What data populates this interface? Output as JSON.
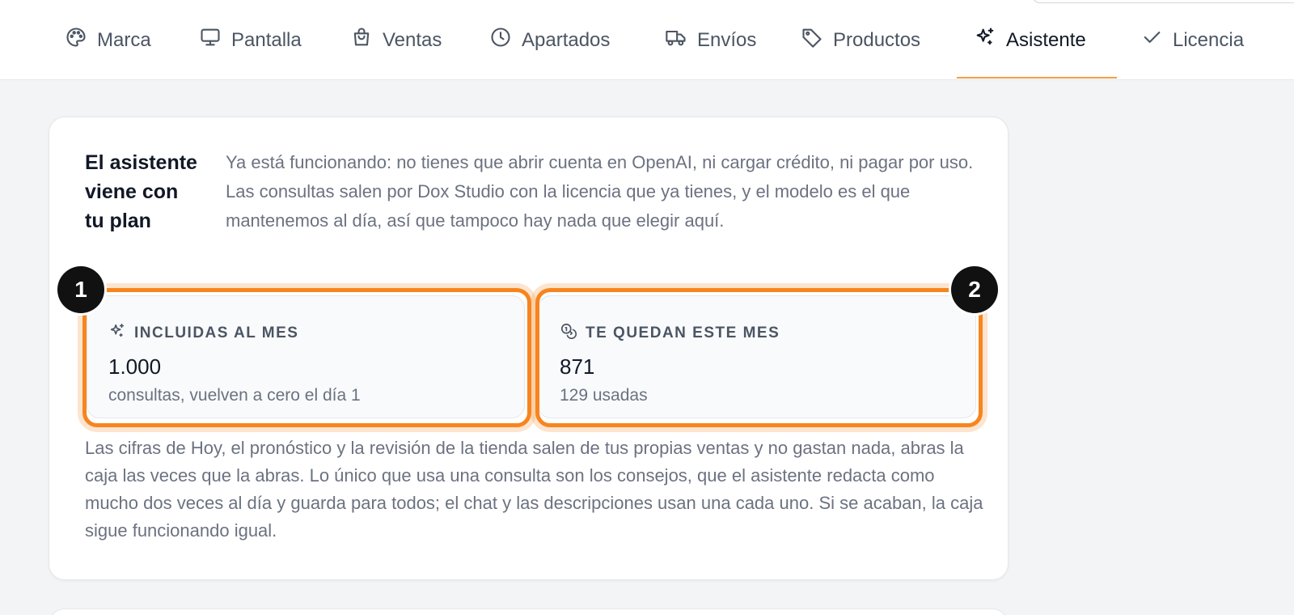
{
  "nav": {
    "tabs": [
      {
        "label": "Marca",
        "icon": "palette-icon"
      },
      {
        "label": "Pantalla",
        "icon": "monitor-icon"
      },
      {
        "label": "Ventas",
        "icon": "shopping-bag-icon"
      },
      {
        "label": "Apartados",
        "icon": "clock-icon"
      },
      {
        "label": "Envíos",
        "icon": "truck-icon"
      },
      {
        "label": "Productos",
        "icon": "tag-icon"
      },
      {
        "label": "Asistente",
        "icon": "sparkles-icon",
        "active": true
      },
      {
        "label": "Licencia",
        "icon": "check-icon"
      }
    ]
  },
  "assistant_card": {
    "title": "El asistente viene con tu plan",
    "lead": "Ya está funcionando: no tienes que abrir cuenta en OpenAI, ni cargar crédito, ni pagar por uso. Las consultas salen por Dox Studio con la licencia que ya tienes, y el modelo es el que mantenemos al día, así que tampoco hay nada que elegir aquí.",
    "stats": [
      {
        "label": "INCLUIDAS AL MES",
        "value": "1.000",
        "sub": "consultas, vuelven a cero el día 1",
        "icon": "sparkles-icon"
      },
      {
        "label": "TE QUEDAN ESTE MES",
        "value": "871",
        "sub": "129 usadas",
        "icon": "coins-icon"
      }
    ],
    "footnote": "Las cifras de Hoy, el pronóstico y la revisión de la tienda salen de tus propias ventas y no gastan nada, abras la caja las veces que la abras. Lo único que usa una consulta son los consejos, que el asistente redacta como mucho dos veces al día y guarda para todos; el chat y las descripciones usan una cada uno. Si se acaban, la caja sigue funcionando igual."
  },
  "annotations": {
    "markers": [
      "1",
      "2"
    ]
  },
  "colors": {
    "accent": "#f6851f",
    "marker": "#111111",
    "muted_text": "#6b7280"
  }
}
